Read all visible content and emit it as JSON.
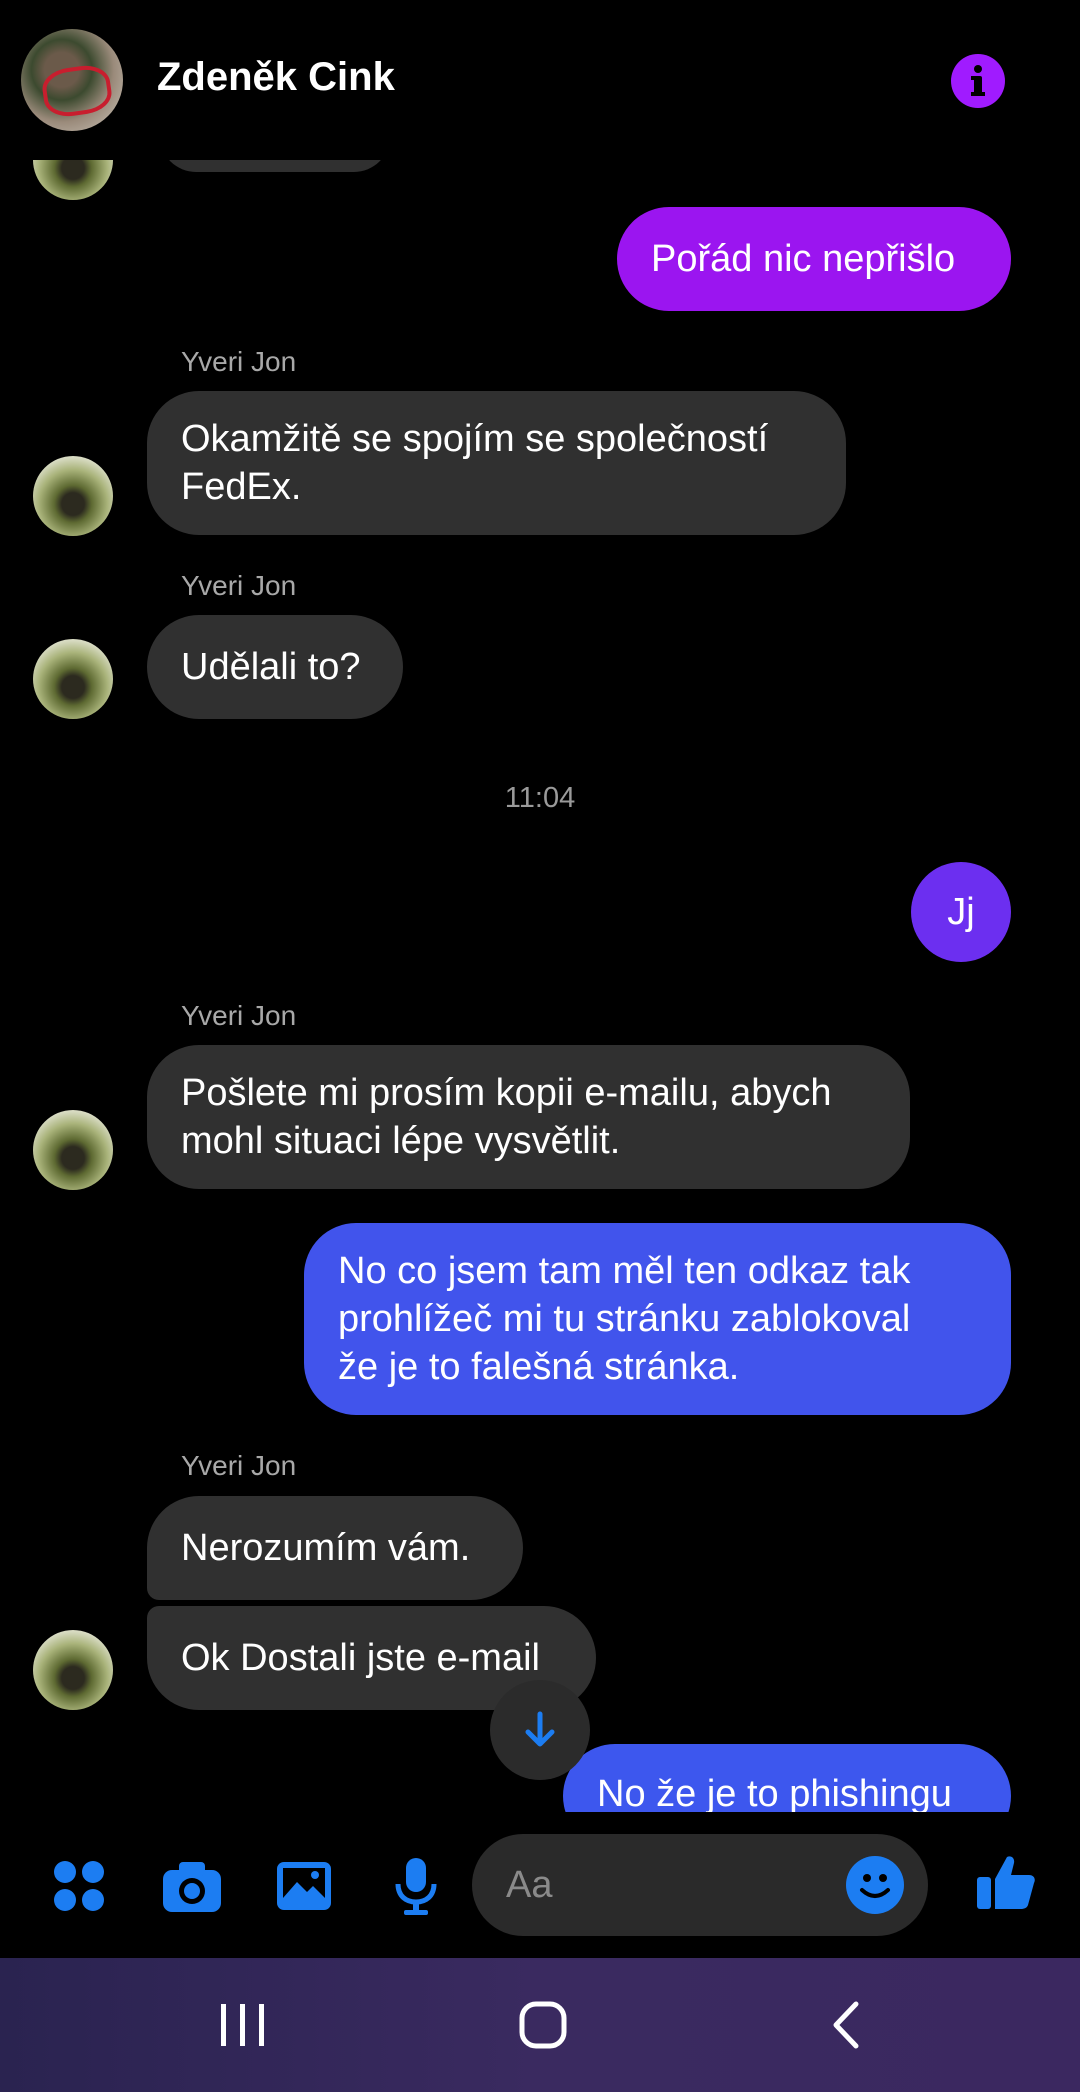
{
  "header": {
    "contact_name": "Zdeněk Cink"
  },
  "chat": {
    "timestamp": "11:04",
    "messages": [
      {
        "sender": "",
        "text": "Pořád nic nepřišlo"
      },
      {
        "sender": "Yveri Jon",
        "text_lines": [
          "Okamžitě se spojím se společností",
          "FedEx."
        ]
      },
      {
        "sender": "Yveri Jon",
        "text": "Udělali to?"
      },
      {
        "sender": "",
        "text": "Jj"
      },
      {
        "sender": "Yveri Jon",
        "text_lines": [
          "Pošlete mi prosím kopii e-mailu, abych",
          "mohl situaci lépe vysvětlit."
        ]
      },
      {
        "sender": "",
        "text_lines": [
          "No co jsem tam měl ten odkaz tak",
          "prohlížeč mi tu stránku zablokoval",
          "že je to falešná stránka."
        ]
      },
      {
        "sender": "Yveri Jon",
        "text": "Nerozumím vám."
      },
      {
        "sender": "",
        "text": "Ok Dostali jste e-mail"
      },
      {
        "sender": "",
        "text": "No že je to phishingu"
      }
    ]
  },
  "composer": {
    "placeholder": "Aa"
  },
  "colors": {
    "accent": "#a01bff",
    "blue": "#1c7df2",
    "incoming_bubble": "#303030"
  },
  "icons": [
    "menu-dots-icon",
    "camera-icon",
    "image-icon",
    "microphone-icon",
    "emoji-icon",
    "thumbs-up-icon",
    "info-icon",
    "arrow-down-icon"
  ]
}
